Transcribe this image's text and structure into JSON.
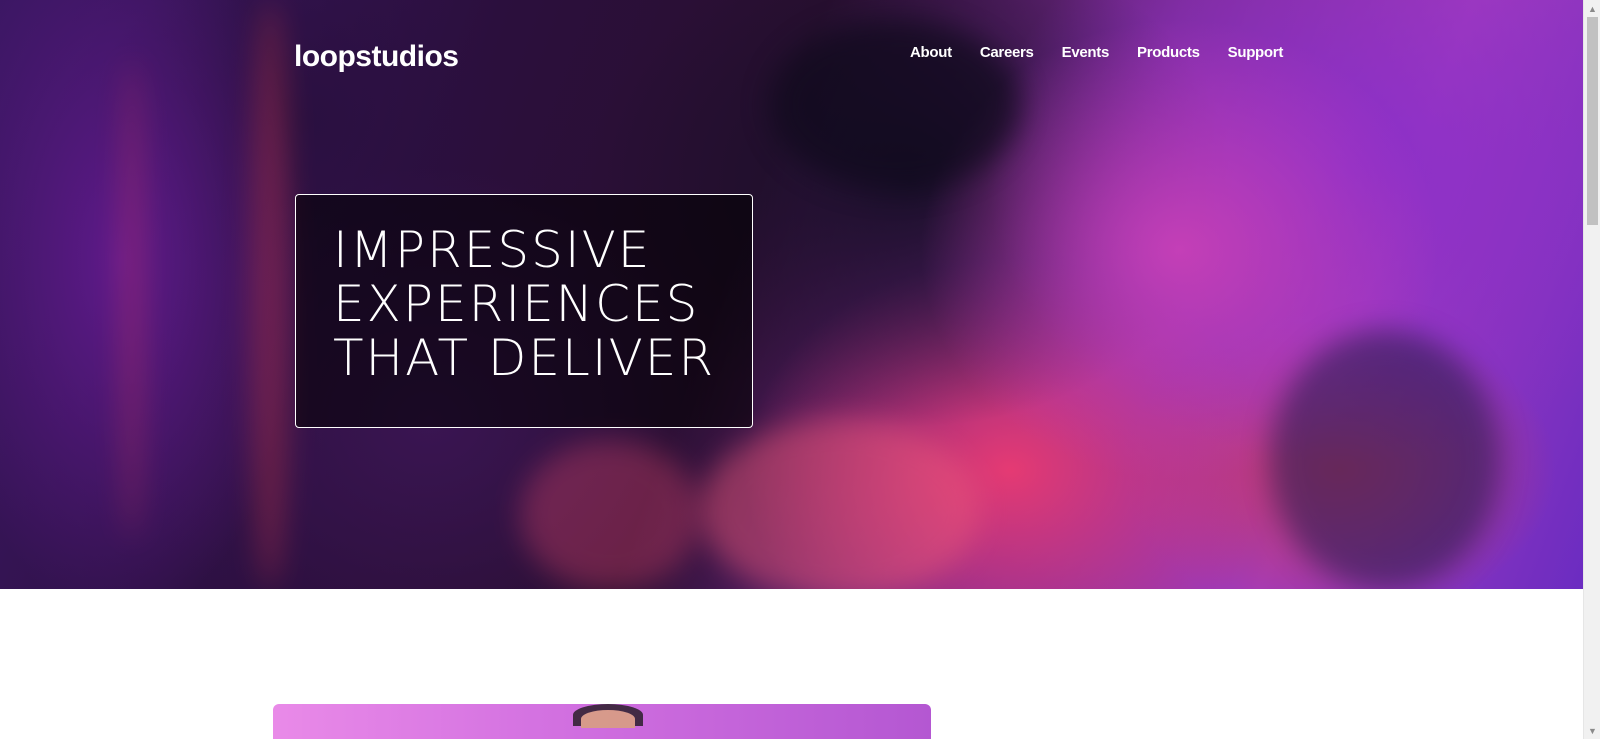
{
  "brand": {
    "logo_text": "loopstudios"
  },
  "nav": {
    "items": [
      {
        "label": "About"
      },
      {
        "label": "Careers"
      },
      {
        "label": "Events"
      },
      {
        "label": "Products"
      },
      {
        "label": "Support"
      }
    ]
  },
  "hero": {
    "headline_lines": [
      "IMPRESSIVE",
      "EXPERIENCES",
      "THAT DELIVER"
    ]
  },
  "colors": {
    "hero_text": "#ffffff",
    "headline_box_border": "#ffffff",
    "page_background": "#ffffff"
  },
  "icons": {
    "scroll_up": "triangle-up",
    "scroll_down": "triangle-down"
  }
}
